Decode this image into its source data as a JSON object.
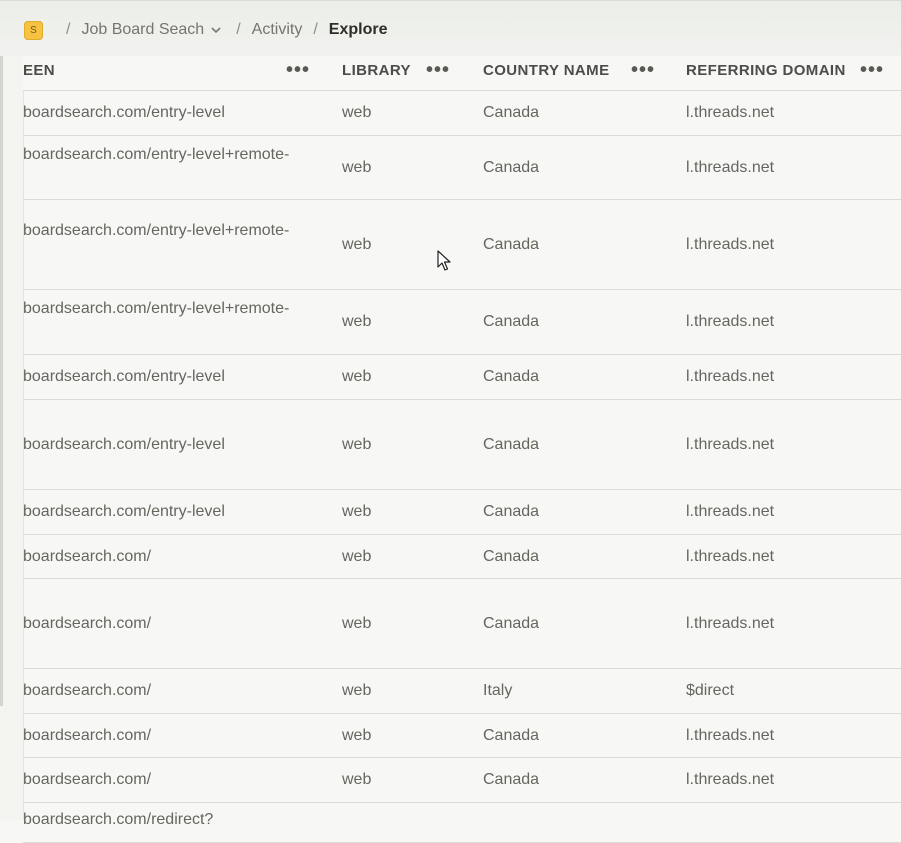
{
  "breadcrumb": {
    "project_icon_letter": "S",
    "project": "Job Board Seach",
    "section": "Activity",
    "current": "Explore",
    "separator": "/"
  },
  "table": {
    "columns": [
      {
        "label": "EEN",
        "menu": "•••"
      },
      {
        "label": "LIBRARY",
        "menu": "•••"
      },
      {
        "label": "COUNTRY NAME",
        "menu": "•••"
      },
      {
        "label": "REFERRING DOMAIN",
        "menu": "•••"
      }
    ],
    "rows": [
      {
        "screen": "boardsearch.com/entry-level",
        "library": "web",
        "country": "Canada",
        "domain": "l.threads.net"
      },
      {
        "screen": "boardsearch.com/entry-level+remote-",
        "library": "web",
        "country": "Canada",
        "domain": "l.threads.net"
      },
      {
        "screen": "boardsearch.com/entry-level+remote-",
        "library": "web",
        "country": "Canada",
        "domain": "l.threads.net"
      },
      {
        "screen": "boardsearch.com/entry-level+remote-",
        "library": "web",
        "country": "Canada",
        "domain": "l.threads.net"
      },
      {
        "screen": "boardsearch.com/entry-level",
        "library": "web",
        "country": "Canada",
        "domain": "l.threads.net"
      },
      {
        "screen": "boardsearch.com/entry-level",
        "library": "web",
        "country": "Canada",
        "domain": "l.threads.net"
      },
      {
        "screen": "boardsearch.com/entry-level",
        "library": "web",
        "country": "Canada",
        "domain": "l.threads.net"
      },
      {
        "screen": "boardsearch.com/",
        "library": "web",
        "country": "Canada",
        "domain": "l.threads.net"
      },
      {
        "screen": "boardsearch.com/",
        "library": "web",
        "country": "Canada",
        "domain": "l.threads.net"
      },
      {
        "screen": "boardsearch.com/",
        "library": "web",
        "country": "Italy",
        "domain": "$direct"
      },
      {
        "screen": "boardsearch.com/",
        "library": "web",
        "country": "Canada",
        "domain": "l.threads.net"
      },
      {
        "screen": "boardsearch.com/",
        "library": "web",
        "country": "Canada",
        "domain": "l.threads.net"
      },
      {
        "screen": "boardsearch.com/redirect?",
        "library": "",
        "country": "",
        "domain": ""
      }
    ]
  },
  "colors": {
    "accent_icon": "#f5c242",
    "border": "#dcdcd7",
    "background": "#f7f7f5"
  }
}
